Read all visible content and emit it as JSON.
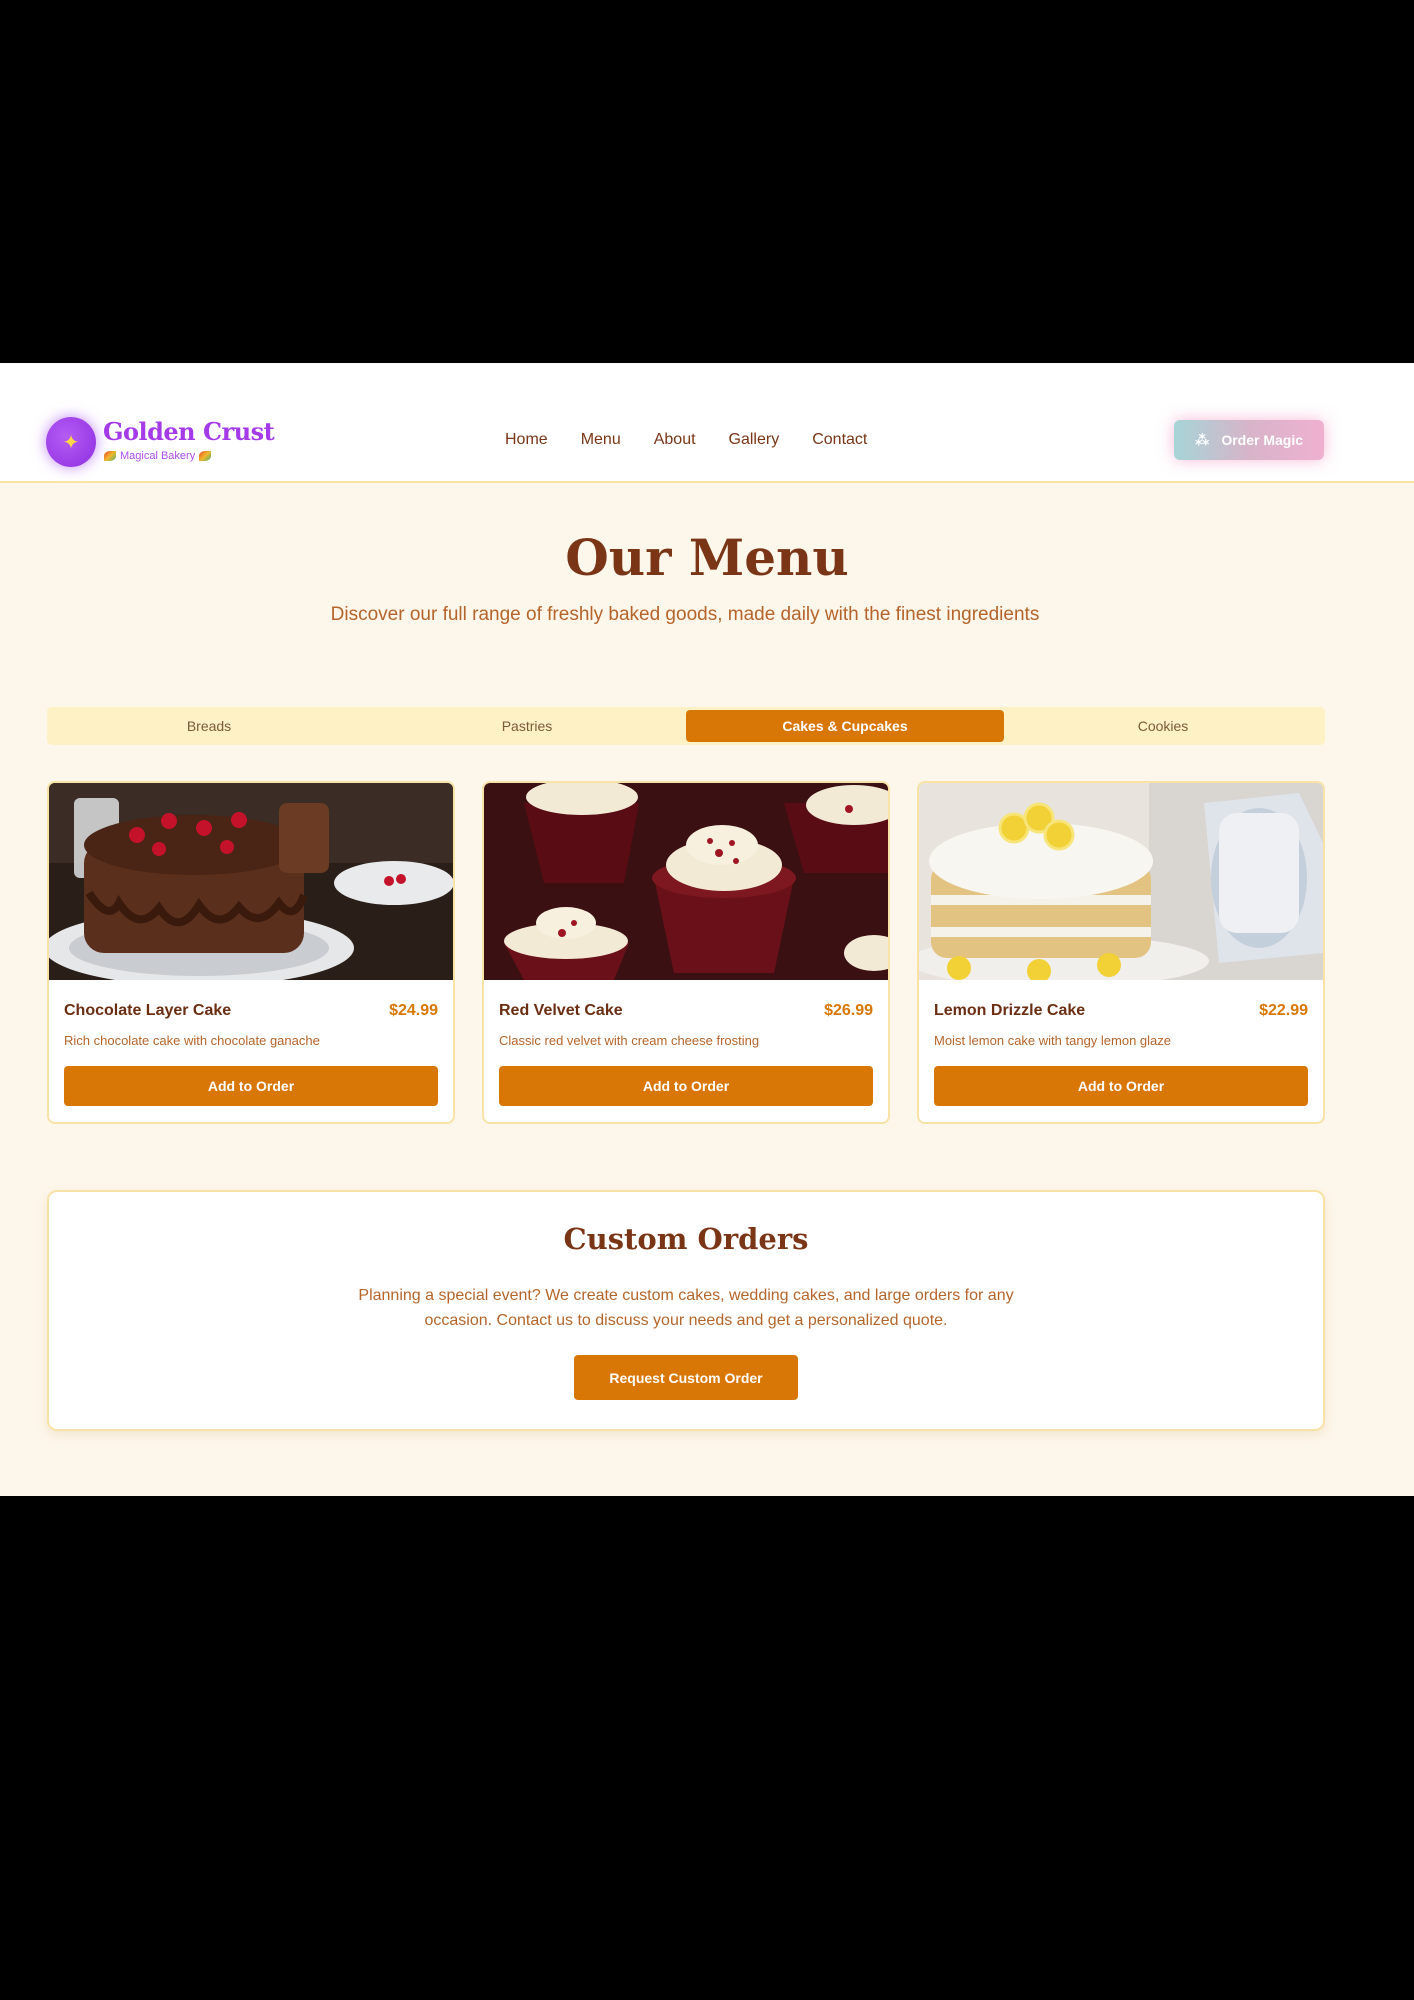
{
  "header": {
    "brand_title": "Golden Crust",
    "brand_subtitle": "Magical Bakery",
    "nav": [
      "Home",
      "Menu",
      "About",
      "Gallery",
      "Contact"
    ],
    "order_button": "Order Magic",
    "icons": {
      "logo": "sparkle-star-icon",
      "leaf": "leaf-icon",
      "order": "sparkles-icon"
    }
  },
  "menu": {
    "title": "Our Menu",
    "subtitle": "Discover our full range of freshly baked goods, made daily with the finest ingredients",
    "tabs": [
      "Breads",
      "Pastries",
      "Cakes & Cupcakes",
      "Cookies"
    ],
    "active_tab": "Cakes & Cupcakes",
    "items": [
      {
        "name": "Chocolate Layer Cake",
        "price": "$24.99",
        "description": "Rich chocolate cake with chocolate ganache",
        "button": "Add to Order"
      },
      {
        "name": "Red Velvet Cake",
        "price": "$26.99",
        "description": "Classic red velvet with cream cheese frosting",
        "button": "Add to Order"
      },
      {
        "name": "Lemon Drizzle Cake",
        "price": "$22.99",
        "description": "Moist lemon cake with tangy lemon glaze",
        "button": "Add to Order"
      }
    ]
  },
  "custom_orders": {
    "title": "Custom Orders",
    "text": "Planning a special event? We create custom cakes, wedding cakes, and large orders for any occasion. Contact us to discuss your needs and get a personalized quote.",
    "button": "Request Custom Order"
  },
  "colors": {
    "accent": "#d97706",
    "brand": "#a43ae8",
    "heading": "#7a3516",
    "background": "#fdf6ea"
  }
}
